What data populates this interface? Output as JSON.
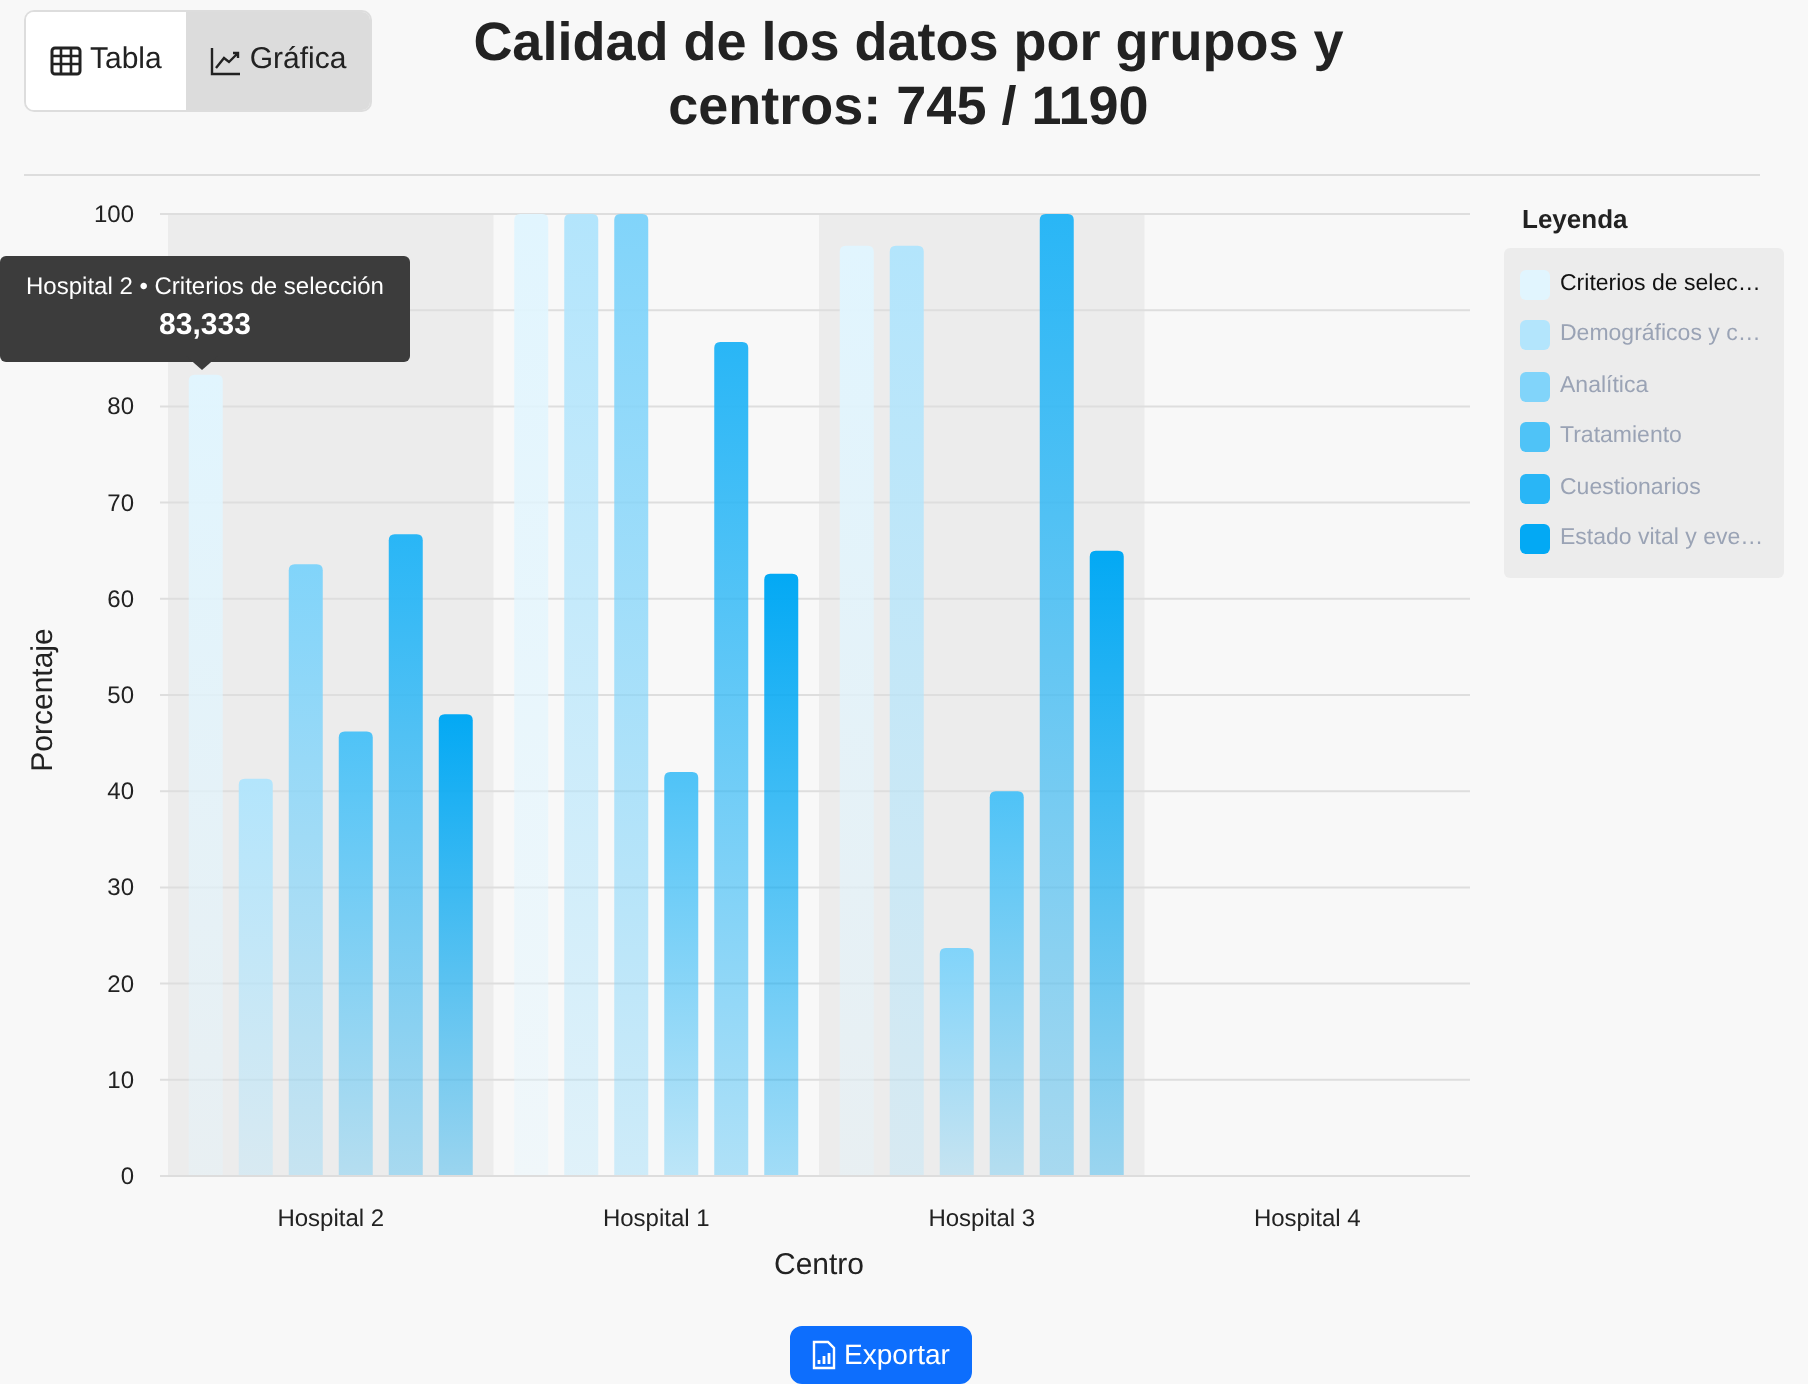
{
  "view_toggle": [
    {
      "label": "Tabla",
      "selected": false
    },
    {
      "label": "Gráfica",
      "selected": true
    }
  ],
  "title": "Calidad de los datos por grupos y centros: 745 / 1190",
  "chart_data": {
    "type": "bar",
    "xlabel": "Centro",
    "ylabel": "Porcentaje",
    "categories": [
      "Hospital 2",
      "Hospital 1",
      "Hospital 3",
      "Hospital 4"
    ],
    "ylim": [
      0,
      100
    ],
    "yticks": [
      0,
      10,
      20,
      30,
      40,
      50,
      60,
      70,
      80,
      100
    ],
    "grid": true,
    "series": [
      {
        "name": "Criterios de selec…",
        "color": "#e1f5fe",
        "values": [
          83.3,
          100,
          96.7,
          null
        ]
      },
      {
        "name": "Demográficos y c…",
        "color": "#b3e5fc",
        "values": [
          41.3,
          100,
          96.7,
          null
        ]
      },
      {
        "name": "Analítica",
        "color": "#81d4fa",
        "values": [
          63.6,
          100,
          23.7,
          null
        ]
      },
      {
        "name": "Tratamiento",
        "color": "#4fc3f7",
        "values": [
          46.2,
          42,
          40,
          null
        ]
      },
      {
        "name": "Cuestionarios",
        "color": "#29b6f6",
        "values": [
          66.7,
          86.7,
          100,
          null
        ]
      },
      {
        "name": "Estado vital y eve…",
        "color": "#03a9f4",
        "values": [
          48,
          62.6,
          65,
          null
        ]
      }
    ]
  },
  "legend": {
    "title": "Leyenda",
    "items": [
      {
        "highlighted": true
      },
      {
        "highlighted": false
      },
      {
        "highlighted": false
      },
      {
        "highlighted": false
      },
      {
        "highlighted": false
      },
      {
        "highlighted": false
      }
    ]
  },
  "tooltip": {
    "title": "Hospital 2 • Criterios de selección",
    "value": "83,333"
  },
  "export_button": {
    "label": "Exportar"
  }
}
